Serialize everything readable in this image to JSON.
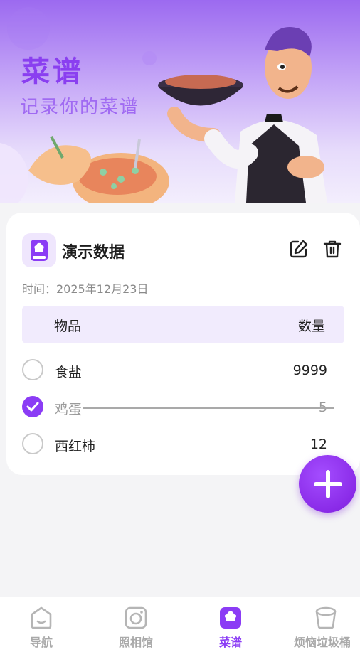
{
  "banner": {
    "title": "菜谱",
    "subtitle": "记录你的菜谱"
  },
  "recipe": {
    "title": "演示数据",
    "time_label": "时间：2025年12月23日",
    "columns": {
      "item": "物品",
      "qty": "数量"
    },
    "items": [
      {
        "name": "食盐",
        "qty": "9999",
        "checked": false
      },
      {
        "name": "鸡蛋",
        "qty": "5",
        "checked": true
      },
      {
        "name": "西红柿",
        "qty": "12",
        "checked": false
      }
    ]
  },
  "tabs": [
    {
      "label": "导航",
      "icon": "home-icon",
      "active": false
    },
    {
      "label": "照相馆",
      "icon": "camera-icon",
      "active": false
    },
    {
      "label": "菜谱",
      "icon": "recipe-book-icon",
      "active": true
    },
    {
      "label": "烦恼垃圾桶",
      "icon": "trash-bin-icon",
      "active": false
    }
  ],
  "colors": {
    "accent": "#8b3cf5",
    "inactive": "#a9a9a9"
  }
}
